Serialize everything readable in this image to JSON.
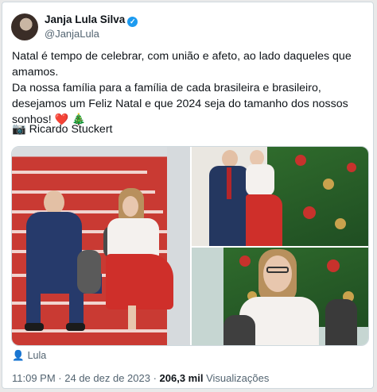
{
  "author": {
    "name": "Janja Lula Silva",
    "handle": "@JanjaLula"
  },
  "tweet": {
    "line1": "Natal é tempo de celebrar, com união e afeto, ao lado daqueles que amamos.",
    "line2": "Da nossa família para a família de cada brasileira e brasileiro, desejamos um Feliz Natal e que 2024 seja do tamanho dos nossos sonhos!",
    "emoji": "❤️ 🎄",
    "credit_icon": "📷",
    "credit": "Ricardo Stuckert"
  },
  "tagged": {
    "name": "Lula"
  },
  "meta": {
    "time": "11:09 PM",
    "date": "24 de dez de 2023",
    "views_count": "206,3 mil",
    "views_label": "Visualizações"
  },
  "icons": [
    "verified-badge-icon",
    "more-icon",
    "camera-icon",
    "person-icon",
    "heart-icon",
    "christmas-tree-icon"
  ],
  "colors": {
    "accent": "#1d9bf0",
    "heart": "#e0245e",
    "muted": "#536471"
  }
}
